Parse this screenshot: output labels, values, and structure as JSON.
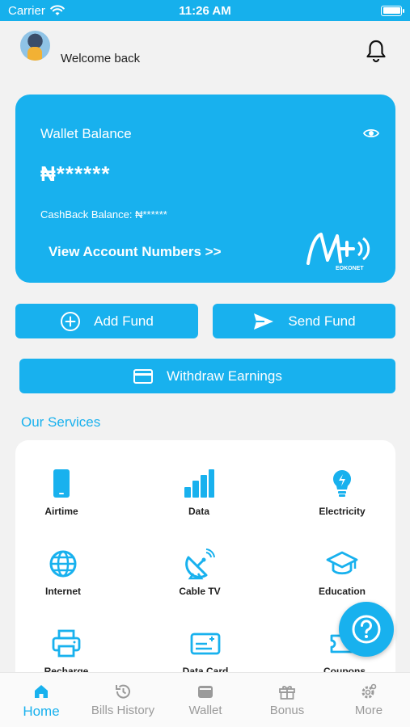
{
  "status_bar": {
    "carrier": "Carrier",
    "time": "11:26 AM",
    "battery_level": 1.0
  },
  "header": {
    "welcome": "Welcome back"
  },
  "wallet_card": {
    "title": "Wallet Balance",
    "balance": "₦******",
    "cashback_label": "CashBack Balance:",
    "cashback_value": "₦******",
    "view_accounts": "View Account Numbers >>",
    "logo_text": "EOKONET"
  },
  "actions": {
    "add_fund": "Add Fund",
    "send_fund": "Send Fund",
    "withdraw": "Withdraw Earnings"
  },
  "services_title": "Our Services",
  "services": [
    {
      "label": "Airtime",
      "icon": "phone-icon"
    },
    {
      "label": "Data",
      "icon": "bar-chart-icon"
    },
    {
      "label": "Electricity",
      "icon": "bulb-icon"
    },
    {
      "label": "Internet",
      "icon": "globe-icon"
    },
    {
      "label": "Cable TV",
      "icon": "satellite-dish-icon"
    },
    {
      "label": "Education",
      "icon": "graduation-cap-icon"
    },
    {
      "label": "Recharge",
      "icon": "printer-icon"
    },
    {
      "label": "Data Card",
      "icon": "card-icon"
    },
    {
      "label": "Coupons",
      "icon": "coupon-icon"
    }
  ],
  "tabs": [
    {
      "label": "Home",
      "icon": "home-icon",
      "active": true
    },
    {
      "label": "Bills History",
      "icon": "history-icon",
      "active": false
    },
    {
      "label": "Wallet",
      "icon": "wallet-icon",
      "active": false
    },
    {
      "label": "Bonus",
      "icon": "gift-icon",
      "active": false
    },
    {
      "label": "More",
      "icon": "gear-icon",
      "active": false
    }
  ],
  "colors": {
    "accent": "#18b1ee",
    "status_bar": "#16b0ec",
    "background": "#f2f2f2",
    "inactive_tab": "#9a9a9a"
  }
}
